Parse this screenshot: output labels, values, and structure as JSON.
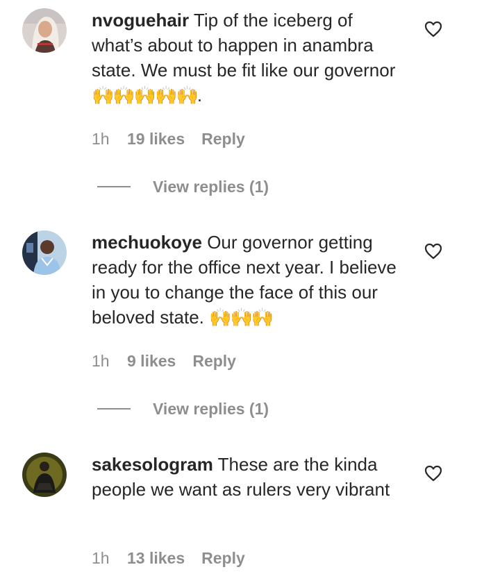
{
  "comments": [
    {
      "username": "nvoguehair",
      "text": "Tip of the iceberg of what’s about to happen in anambra state. We must be fit like our governor",
      "emoji": "🙌🙌🙌🙌🙌",
      "trailing": ".",
      "time": "1h",
      "likes": "19 likes",
      "reply": "Reply",
      "view_replies": "View replies (1)"
    },
    {
      "username": "mechuokoye",
      "text": "Our governor getting ready for the office next year. I believe in you to change the face of this our beloved state. ",
      "emoji": "🙌🙌🙌",
      "trailing": "",
      "time": "1h",
      "likes": "9 likes",
      "reply": "Reply",
      "view_replies": "View replies (1)"
    },
    {
      "username": "sakesologram",
      "text": "These are the kinda people we want as rulers very vibrant",
      "emoji": "",
      "trailing": "",
      "time": "1h",
      "likes": "13 likes",
      "reply": "Reply"
    }
  ],
  "icons": {
    "like": "heart-outline-icon",
    "avatar": "user-avatar"
  },
  "colors": {
    "text": "#262626",
    "muted": "#8e8e8e",
    "background": "#ffffff",
    "emoji": "#f5b800"
  }
}
